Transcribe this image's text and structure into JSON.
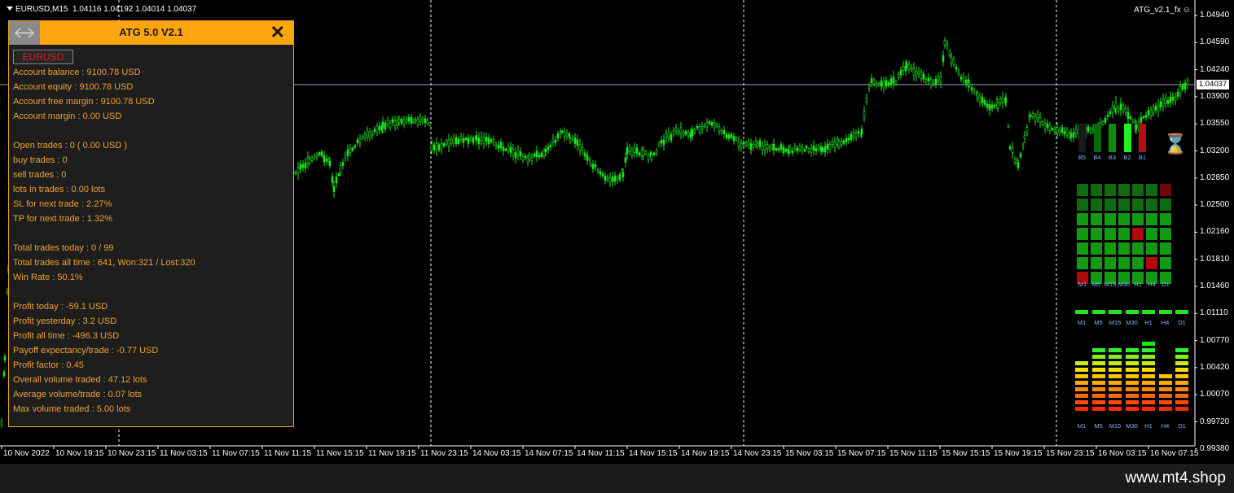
{
  "chart_header": {
    "symbol": "EURUSD,M15",
    "ohlc": "1.04116 1.04192 1.04014 1.04037"
  },
  "indicator_name": "ATG_v2.1_fx",
  "current_price": "1.04037",
  "y_axis": [
    "1.04940",
    "1.04590",
    "1.04240",
    "1.03900",
    "1.03550",
    "1.03200",
    "1.02850",
    "1.02500",
    "1.02160",
    "1.01810",
    "1.01460",
    "1.01110",
    "1.00770",
    "1.00420",
    "1.00070",
    "0.99720",
    "0.99380"
  ],
  "x_axis": [
    "10 Nov 2022",
    "10 Nov 19:15",
    "10 Nov 23:15",
    "11 Nov 03:15",
    "11 Nov 07:15",
    "11 Nov 11:15",
    "11 Nov 15:15",
    "11 Nov 19:15",
    "11 Nov 23:15",
    "14 Nov 03:15",
    "14 Nov 07:15",
    "14 Nov 11:15",
    "14 Nov 15:15",
    "14 Nov 19:15",
    "14 Nov 23:15",
    "15 Nov 03:15",
    "15 Nov 07:15",
    "15 Nov 11:15",
    "15 Nov 15:15",
    "15 Nov 19:15",
    "15 Nov 23:15",
    "16 Nov 03:15",
    "16 Nov 07:15"
  ],
  "panel": {
    "title": "ATG 5.0 V2.1",
    "close_icon": "✕",
    "symbol_button": "EURUSD",
    "lines": [
      "Account balance : 9100.78 USD",
      "Account equity : 9100.78 USD",
      "Account free margin : 9100.78 USD",
      "Account margin : 0.00 USD",
      "",
      "Open trades : 0 ( 0.00 USD )",
      "buy trades : 0",
      "sell trades : 0",
      "lots in trades : 0.00 lots",
      "SL for next trade : 2.27%",
      "TP for next trade : 1.32%",
      "",
      "Total trades today : 0 / 99",
      "Total trades all time : 641, Won:321 / Lost:320",
      "Win Rate : 50.1%",
      "",
      "Profit today : -59.1 USD",
      "Profit yesterday : 3.2 USD",
      "Profit all time : -496.3 USD",
      "Payoff expectancy/trade : -0.77 USD",
      "Profit factor : 0.45",
      "Overall volume traded : 47.12 lots",
      "Average volume/trade : 0.07 lots",
      "Max volume traded : 5.00 lots"
    ]
  },
  "bar_widget": {
    "labels": [
      "B5",
      "B4",
      "B3",
      "B2",
      "B1"
    ],
    "colors": [
      "#1a1a1a",
      "#0a6a0a",
      "#0f8a0f",
      "#1ef01e",
      "#b01010"
    ],
    "levels": [
      0.45,
      0.45,
      0.45,
      0.45,
      0.45
    ],
    "hourglass": "⌛"
  },
  "grid_widget": {
    "labels": [
      "M1",
      "M5",
      "M15",
      "M30",
      "H1",
      "H4",
      "D1"
    ],
    "cells": [
      [
        "g",
        "g",
        "g",
        "g",
        "g",
        "g",
        "r"
      ],
      [
        "g",
        "g",
        "g",
        "g",
        "g",
        "g",
        "g"
      ],
      [
        "g",
        "g",
        "g",
        "g",
        "g",
        "g",
        "g"
      ],
      [
        "g",
        "g",
        "g",
        "g",
        "r",
        "g",
        "g"
      ],
      [
        "g",
        "g",
        "g",
        "g",
        "g",
        "g",
        "g"
      ],
      [
        "g",
        "g",
        "g",
        "g",
        "g",
        "r",
        "g"
      ],
      [
        "r",
        "g",
        "g",
        "g",
        "g",
        "g",
        "g"
      ]
    ]
  },
  "strip_widget": {
    "labels": [
      "M1",
      "M5",
      "M15",
      "M30",
      "H1",
      "H4",
      "D1"
    ]
  },
  "eq_widget": {
    "labels": [
      "M1",
      "M5",
      "M15",
      "M30",
      "H1",
      "H4",
      "D1"
    ],
    "levels": [
      8,
      10,
      10,
      10,
      11,
      6,
      10
    ]
  },
  "brand": "www.mt4.shop"
}
